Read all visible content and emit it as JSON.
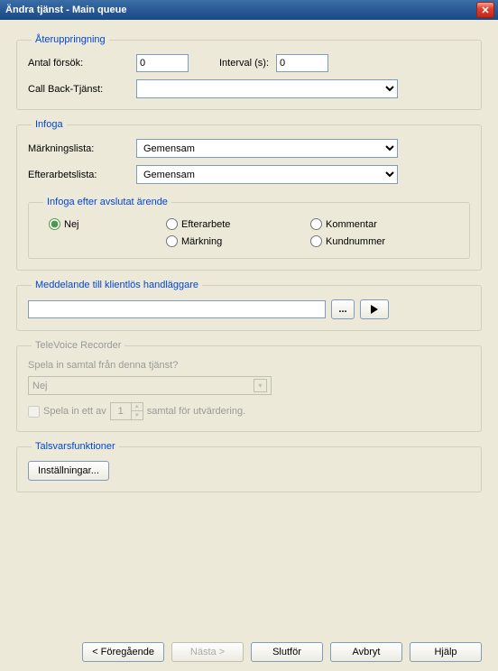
{
  "window": {
    "title": "Ändra tjänst - Main queue"
  },
  "ater": {
    "legend": "Återuppringning",
    "antal_label": "Antal försök:",
    "antal_value": "0",
    "interval_label": "Interval (s):",
    "interval_value": "0",
    "callback_label": "Call Back-Tjänst:",
    "callback_value": ""
  },
  "infoga": {
    "legend": "Infoga",
    "mark_label": "Märkningslista:",
    "mark_value": "Gemensam",
    "efter_label": "Efterarbetslista:",
    "efter_value": "Gemensam",
    "sub_legend": "Infoga efter avslutat ärende",
    "radios": {
      "nej": "Nej",
      "efterarbete": "Efterarbete",
      "kommentar": "Kommentar",
      "markning": "Märkning",
      "kundnummer": "Kundnummer"
    },
    "selected": "nej"
  },
  "medd": {
    "legend": "Meddelande till klientlös handläggare",
    "value": "",
    "browse_label": "..."
  },
  "recorder": {
    "legend": "TeleVoice Recorder",
    "question": "Spela in samtal från denna tjänst?",
    "value": "Nej",
    "chk_pre": "Spela in ett av",
    "chk_num": "1",
    "chk_post": "samtal för utvärdering."
  },
  "talsvar": {
    "legend": "Talsvarsfunktioner",
    "btn": "Inställningar..."
  },
  "footer": {
    "prev": "< Föregående",
    "next": "Nästa >",
    "finish": "Slutför",
    "cancel": "Avbryt",
    "help": "Hjälp"
  }
}
